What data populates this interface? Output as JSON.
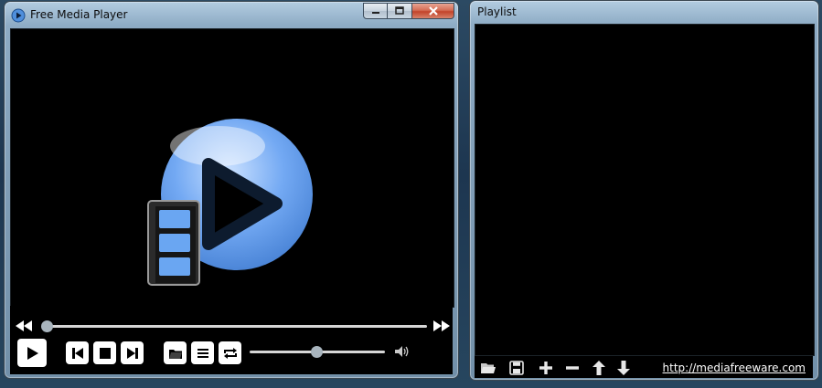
{
  "player": {
    "title": "Free Media Player",
    "caption_buttons": [
      "minimize-icon",
      "maximize-icon",
      "close-icon"
    ],
    "seek": {
      "position": 0
    },
    "volume": {
      "level": 0.49
    },
    "controls": [
      "rewind-icon",
      "fast-forward-icon",
      "play-icon",
      "previous-icon",
      "stop-icon",
      "next-icon",
      "open-folder-icon",
      "playlist-icon",
      "repeat-icon",
      "speaker-icon"
    ]
  },
  "playlist": {
    "title": "Playlist",
    "toolbar": [
      "open-folder-icon",
      "save-icon",
      "add-icon",
      "remove-icon",
      "move-up-icon",
      "move-down-icon"
    ],
    "link": "http://mediafreeware.com"
  },
  "colors": {
    "accent": "#6aa6f2",
    "button_face": "#ffffff",
    "video_bg": "#000000"
  }
}
